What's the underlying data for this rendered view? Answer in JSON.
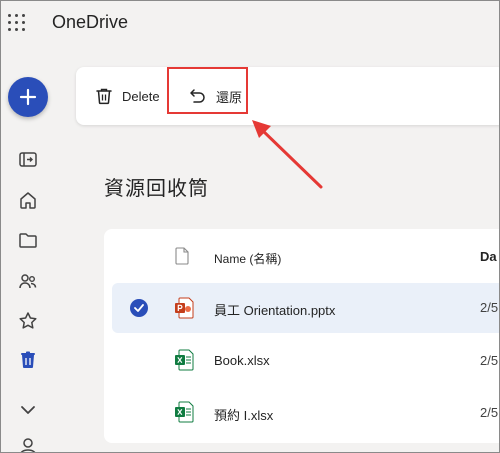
{
  "app": {
    "title": "OneDrive"
  },
  "command_bar": {
    "delete_label": "Delete",
    "restore_label": "還原"
  },
  "page": {
    "title": "資源回收筒"
  },
  "list": {
    "columns": {
      "name": "Name (名稱)",
      "date": "Da"
    },
    "rows": [
      {
        "name": "員工 Orientation.pptx",
        "date": "2/5",
        "type": "pptx",
        "selected": true
      },
      {
        "name": "Book.xlsx",
        "date": "2/5",
        "type": "xlsx",
        "selected": false
      },
      {
        "name": "預約 I.xlsx",
        "date": "2/5",
        "type": "xlsx",
        "selected": false
      }
    ]
  },
  "icons": {
    "rail": [
      "plus-icon",
      "expand-rail-icon",
      "home-icon",
      "folder-icon",
      "people-icon",
      "star-icon",
      "recycle-bin-icon",
      "chevron-down-icon",
      "person-icon"
    ]
  },
  "colors": {
    "accent": "#2a4eb9",
    "annotation": "#e53935",
    "powerpoint": "#c43e1c",
    "excel": "#107c41"
  }
}
